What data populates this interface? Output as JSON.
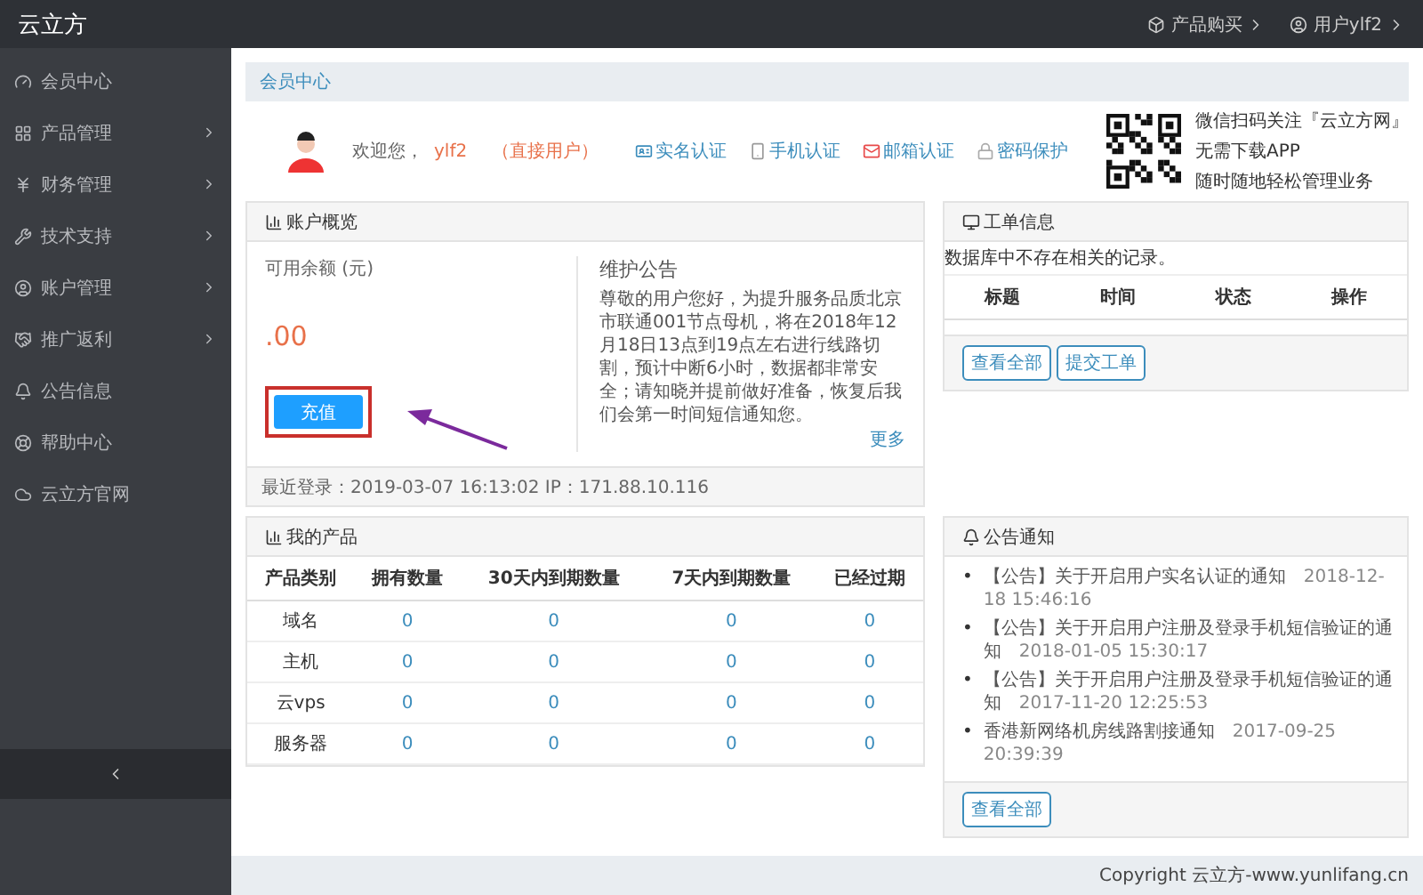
{
  "app": {
    "logo": "云立方"
  },
  "top_nav": [
    {
      "label": "产品购买"
    },
    {
      "label": "用户ylf2"
    }
  ],
  "sidebar": {
    "items": [
      {
        "label": "会员中心",
        "has_submenu": false
      },
      {
        "label": "产品管理",
        "has_submenu": true
      },
      {
        "label": "财务管理",
        "has_submenu": true
      },
      {
        "label": "技术支持",
        "has_submenu": true
      },
      {
        "label": "账户管理",
        "has_submenu": true
      },
      {
        "label": "推广返利",
        "has_submenu": true
      },
      {
        "label": "公告信息",
        "has_submenu": false
      },
      {
        "label": "帮助中心",
        "has_submenu": false
      },
      {
        "label": "云立方官网",
        "has_submenu": false
      }
    ]
  },
  "breadcrumb": "会员中心",
  "welcome": {
    "greeting": "欢迎您，",
    "username": "ylf2",
    "user_type": "（直接用户）",
    "verifications": [
      {
        "label": "实名认证"
      },
      {
        "label": "手机认证"
      },
      {
        "label": "邮箱认证"
      },
      {
        "label": "密码保护"
      }
    ]
  },
  "qr_lines": [
    "微信扫码关注『云立方网』",
    "无需下载APP",
    "随时随地轻松管理业务"
  ],
  "account_overview": {
    "title": "账户概览",
    "balance_label": "可用余额 (元)",
    "balance": ".00",
    "recharge_button": "充值",
    "highlighted": true,
    "notice_title": "维护公告",
    "notice_text": "尊敬的用户您好，为提升服务品质北京市联通001节点母机，将在2018年12月18日13点到19点左右进行线路切割，预计中断6小时，数据都非常安全；请知晓并提前做好准备，恢复后我们会第一时间短信通知您。",
    "more_link": "更多",
    "last_login": "最近登录：2019-03-07 16:13:02 IP：171.88.10.116"
  },
  "tickets": {
    "title": "工单信息",
    "empty_message": "数据库中不存在相关的记录。",
    "columns": [
      "标题",
      "时间",
      "状态",
      "操作"
    ],
    "buttons": [
      "查看全部",
      "提交工单"
    ]
  },
  "products": {
    "title": "我的产品",
    "columns": [
      "产品类别",
      "拥有数量",
      "30天内到期数量",
      "7天内到期数量",
      "已经过期"
    ],
    "rows": [
      {
        "category": "域名",
        "values": [
          "0",
          "0",
          "0",
          "0"
        ]
      },
      {
        "category": "主机",
        "values": [
          "0",
          "0",
          "0",
          "0"
        ]
      },
      {
        "category": "云vps",
        "values": [
          "0",
          "0",
          "0",
          "0"
        ]
      },
      {
        "category": "服务器",
        "values": [
          "0",
          "0",
          "0",
          "0"
        ]
      }
    ]
  },
  "announcements": {
    "title": "公告通知",
    "items": [
      {
        "marker": "•",
        "text": "【公告】关于开启用户实名认证的通知",
        "date": "2018-12-18 15:46:16"
      },
      {
        "marker": "•",
        "text": "【公告】关于开启用户注册及登录手机短信验证的通知",
        "date": "2018-01-05 15:30:17"
      },
      {
        "marker": "•",
        "text": "【公告】关于开启用户注册及登录手机短信验证的通知",
        "date": "2017-11-20 12:25:53"
      },
      {
        "marker": "•",
        "text": "香港新网络机房线路割接通知",
        "date": "2017-09-25 20:39:39"
      }
    ],
    "button": "查看全部"
  },
  "footer": "Copyright 云立方-www.yunlifang.cn"
}
